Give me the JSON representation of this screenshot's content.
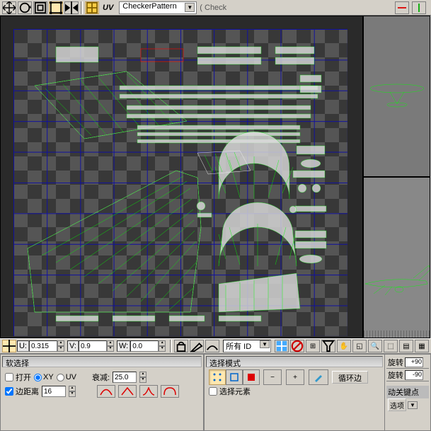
{
  "toolbar": {
    "uv_label": "UV",
    "material_dropdown": "CheckerPattern",
    "material_suffix": "( Check"
  },
  "coords": {
    "u_label": "U:",
    "u_value": "0.315",
    "v_label": "V:",
    "v_value": "0.9",
    "w_label": "W:",
    "w_value": "0.0",
    "id_dropdown": "所有 ID"
  },
  "soft_select": {
    "title": "软选择",
    "open_label": "打开",
    "xy_label": "XY",
    "uv_label": "UV",
    "edge_dist_label": "边距离",
    "edge_dist_value": "16",
    "falloff_label": "衰减:",
    "falloff_value": "25.0"
  },
  "select_mode": {
    "title": "选择模式",
    "select_element_label": "选择元素",
    "cycle_btn": "循环边"
  },
  "right": {
    "rotate_label": "旋转",
    "rotate_plus": "+90",
    "rotate_minus": "-90",
    "auto_key": "动关键点",
    "options_btn": "选项"
  }
}
